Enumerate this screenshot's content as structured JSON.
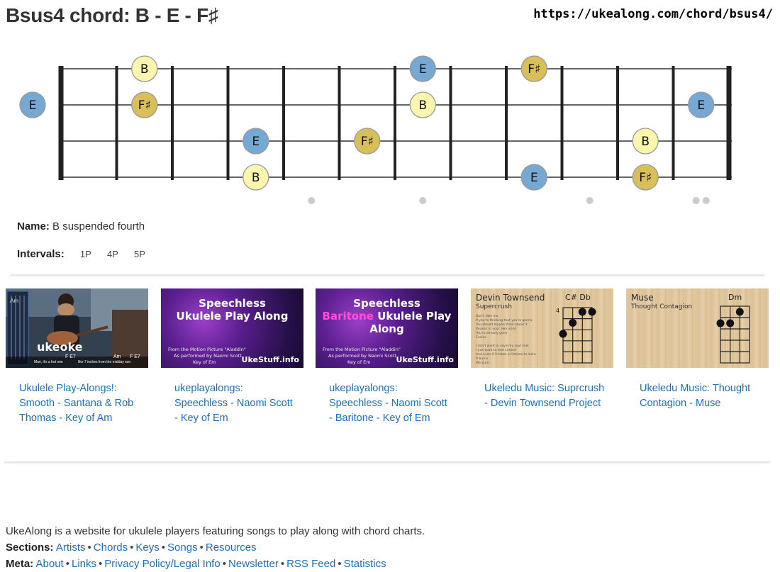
{
  "page": {
    "title": "Bsus4 chord: B - E - F♯",
    "url": "https://ukealong.com/chord/bsus4/"
  },
  "chord": {
    "name_label": "Name:",
    "name_value": "B suspended fourth",
    "intervals_label": "Intervals:",
    "intervals": [
      "1P",
      "4P",
      "5P"
    ]
  },
  "fretboard": {
    "strings": 4,
    "frets": 12,
    "open_notes": [
      {
        "string": 2,
        "note": "E",
        "type": "third"
      }
    ],
    "notes": [
      {
        "string": 1,
        "fret": 2,
        "note": "B",
        "type": "root"
      },
      {
        "string": 2,
        "fret": 2,
        "note": "F♯",
        "type": "fifth"
      },
      {
        "string": 3,
        "fret": 4,
        "note": "E",
        "type": "third"
      },
      {
        "string": 4,
        "fret": 4,
        "note": "B",
        "type": "root"
      },
      {
        "string": 3,
        "fret": 6,
        "note": "F♯",
        "type": "fifth"
      },
      {
        "string": 1,
        "fret": 7,
        "note": "E",
        "type": "third"
      },
      {
        "string": 2,
        "fret": 7,
        "note": "B",
        "type": "root"
      },
      {
        "string": 1,
        "fret": 9,
        "note": "F♯",
        "type": "fifth"
      },
      {
        "string": 4,
        "fret": 9,
        "note": "E",
        "type": "third"
      },
      {
        "string": 3,
        "fret": 11,
        "note": "B",
        "type": "root"
      },
      {
        "string": 4,
        "fret": 11,
        "note": "F♯",
        "type": "fifth"
      },
      {
        "string": 2,
        "fret": 12,
        "note": "E",
        "type": "third"
      }
    ],
    "single_markers": [
      5,
      7,
      10
    ],
    "double_markers": [
      12
    ],
    "colors": {
      "root": "#fbf6ad",
      "third": "#76a8d4",
      "fifth": "#d9bf59",
      "stroke": "#999999",
      "fret": "#222222",
      "string": "#333333",
      "marker": "#cccccc"
    }
  },
  "videos": [
    {
      "link": "Ukulele Play-Alongs!: Smooth - Santana & Rob Thomas - Key of Am",
      "thumb": {
        "style": "photo",
        "word": "ukeoke",
        "chords": [
          "Am",
          "F E7",
          "Am",
          "F E7"
        ],
        "sub": "Man, it's a hot one",
        "sub2": "like 7 inches from the midday sun"
      }
    },
    {
      "link": "ukeplayalongs: Speechless - Naomi Scott - Key of Em",
      "thumb": {
        "style": "purple",
        "line1": "Speechless",
        "line2a": "",
        "line2b": "Ukulele Play Along",
        "small1": "From the Motion Picture \"Aladdin\"",
        "small2": "As performed by Naomi Scott",
        "small3": "Key of Em",
        "brand": "UkeStuff.info"
      }
    },
    {
      "link": "ukeplayalongs: Speechless - Naomi Scott - Baritone - Key of Em",
      "thumb": {
        "style": "purple",
        "line1": "Speechless",
        "line2a": "Baritone",
        "line2b": " Ukulele Play Along",
        "small1": "From the Motion Picture \"Aladdin\"",
        "small2": "As performed by Naomi Scott",
        "small3": "Key of Em",
        "brand": "UkeStuff.info"
      }
    },
    {
      "link": "Ukeledu Music: Suprcrush - Devin Townsend Project",
      "thumb": {
        "style": "wood",
        "artist": "Devin Townsend",
        "song": "Supercrush",
        "chord": "C# Db",
        "fret_label": "4",
        "lyrics": [
          "Don't fake me",
          "If you're thinking that you're gonna",
          "You should maybe think about it",
          "Reason in your own mind",
          "You're already gone",
          "Evolve",
          "",
          "I don't want to save my soul now",
          "I just want to lose control",
          "And even if it takes a lifetime to learn",
          "It burns",
          "We burn"
        ]
      }
    },
    {
      "link": "Ukeledu Music: Thought Contagion - Muse",
      "thumb": {
        "style": "wood",
        "artist": "Muse",
        "song": "Thought Contagion",
        "chord": "Dm",
        "fret_label": "",
        "lyrics": []
      }
    }
  ],
  "footer": {
    "about": "UkeAlong is a website for ukulele players featuring songs to play along with chord charts.",
    "sections_label": "Sections:",
    "sections": [
      "Artists",
      "Chords",
      "Keys",
      "Songs",
      "Resources"
    ],
    "meta_label": "Meta:",
    "meta": [
      "About",
      "Links",
      "Privacy Policy/Legal Info",
      "Newsletter",
      "RSS Feed",
      "Statistics"
    ]
  }
}
